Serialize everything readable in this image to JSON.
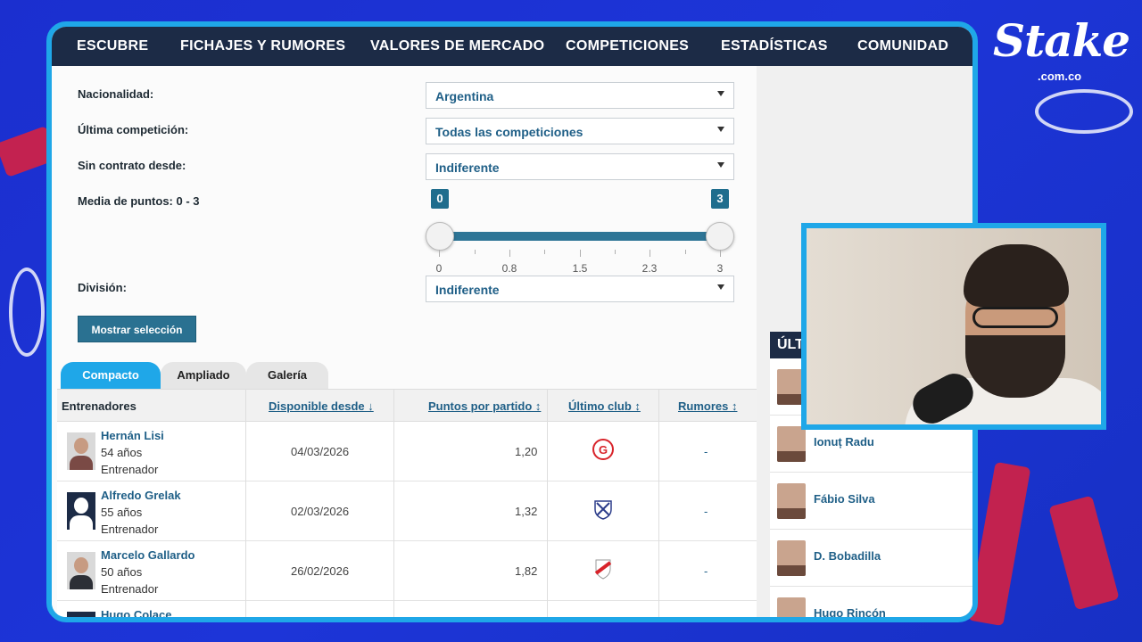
{
  "nav": {
    "items": [
      "ESCUBRE",
      "FICHAJES Y RUMORES",
      "VALORES DE MERCADO",
      "COMPETICIONES",
      "ESTADÍSTICAS",
      "COMUNIDAD"
    ]
  },
  "filters": {
    "nationality_label": "Nacionalidad:",
    "nationality_value": "Argentina",
    "competition_label": "Última competición:",
    "competition_value": "Todas las competiciones",
    "contract_label": "Sin contrato desde:",
    "contract_value": "Indiferente",
    "points_label": "Media de puntos:",
    "points_range": "0 - 3",
    "division_label": "División:",
    "division_value": "Indiferente",
    "submit_label": "Mostrar selección"
  },
  "slider": {
    "min_badge": "0",
    "max_badge": "3",
    "min_value": 0,
    "max_value": 3,
    "tick_labels": [
      "0",
      "0.8",
      "1.5",
      "2.3",
      "3"
    ]
  },
  "tabs": [
    "Compacto",
    "Ampliado",
    "Galería"
  ],
  "table": {
    "headers": {
      "coaches": "Entrenadores",
      "available": "Disponible desde ↓",
      "points": "Puntos por partido ↕",
      "club": "Último club ↕",
      "rumors": "Rumores ↕"
    },
    "rows": [
      {
        "name": "Hernán Lisi",
        "age": "54 años",
        "role": "Entrenador",
        "available": "04/03/2026",
        "points": "1,20",
        "rumors": "-"
      },
      {
        "name": "Alfredo Grelak",
        "age": "55 años",
        "role": "Entrenador",
        "available": "02/03/2026",
        "points": "1,32",
        "rumors": "-"
      },
      {
        "name": "Marcelo Gallardo",
        "age": "50 años",
        "role": "Entrenador",
        "available": "26/02/2026",
        "points": "1,82",
        "rumors": "-"
      },
      {
        "name": "Hugo Colace",
        "age": "",
        "role": "",
        "available": "",
        "points": "",
        "rumors": ""
      }
    ]
  },
  "news": {
    "title": "ÚLTI",
    "items": [
      "Ionuț Radu",
      "Fábio Silva",
      "D. Bobadilla",
      "Hugo Rincón"
    ]
  },
  "brand": {
    "name": "Stake",
    "domain": ".com.co"
  },
  "colors": {
    "accent": "#1fa7e8",
    "nav": "#1c2b46",
    "link": "#1f5f87"
  }
}
